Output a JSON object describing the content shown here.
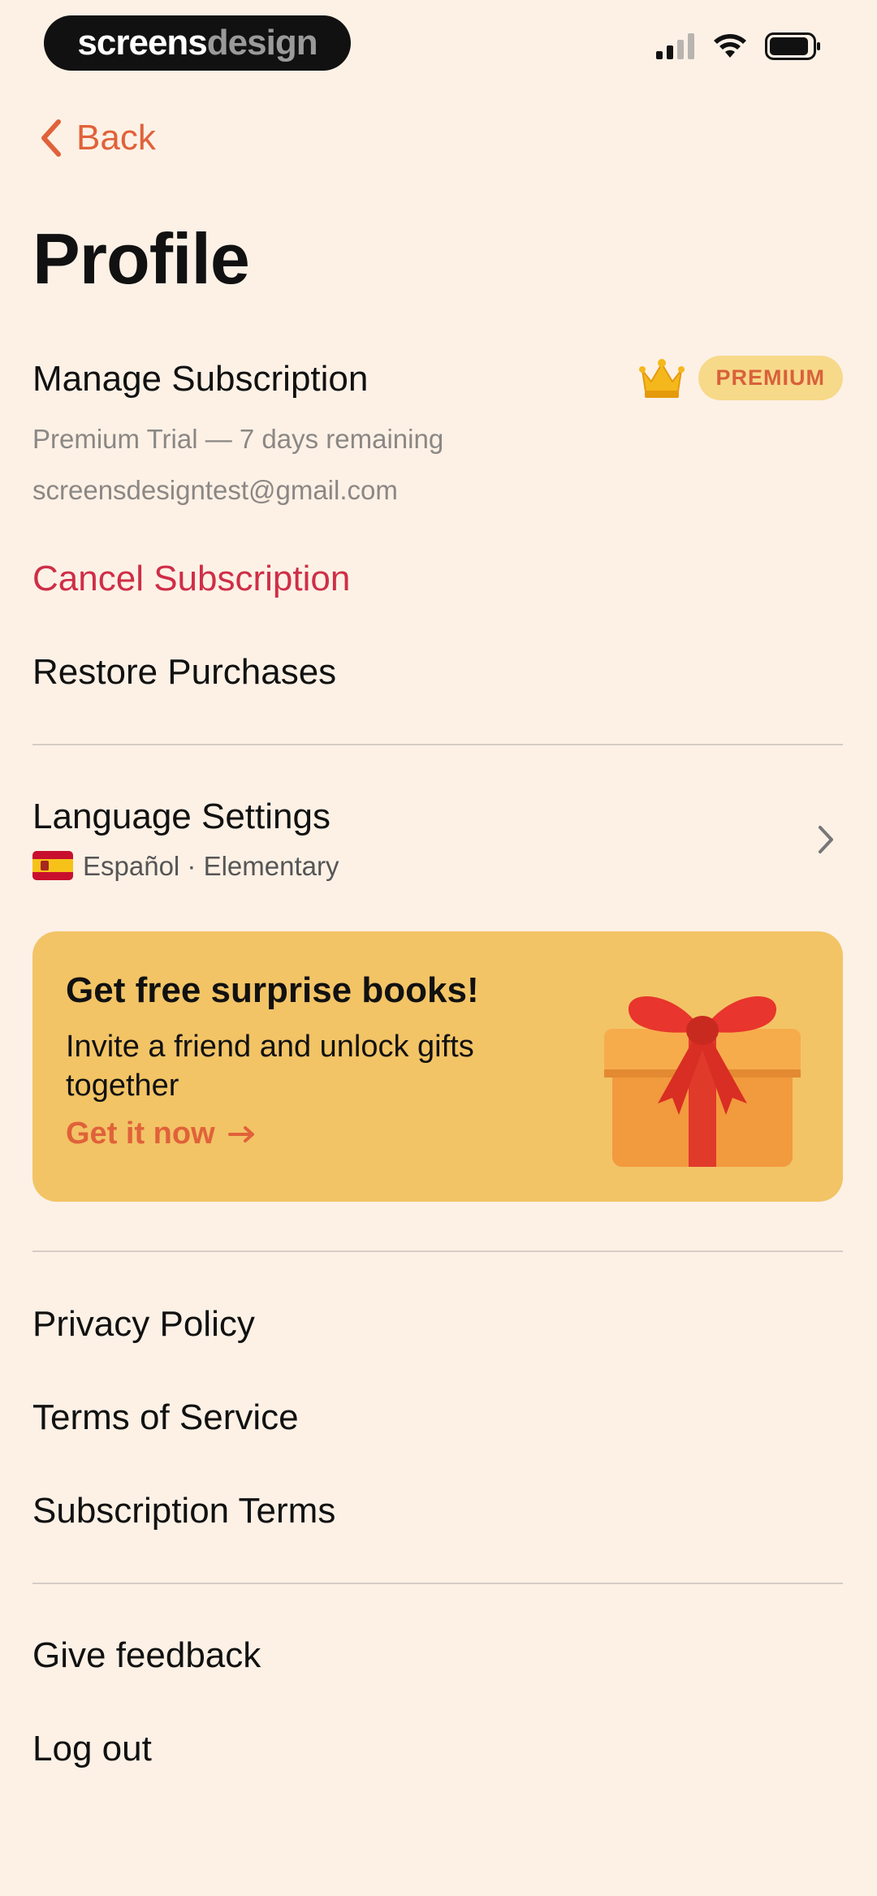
{
  "status_bar": {
    "brand_part1": "screens",
    "brand_part2": "design"
  },
  "nav": {
    "back_label": "Back"
  },
  "page": {
    "title": "Profile"
  },
  "subscription": {
    "heading": "Manage Subscription",
    "badge": "PREMIUM",
    "trial_text": "Premium Trial — 7 days remaining",
    "email": "screensdesigntest@gmail.com",
    "cancel_label": "Cancel Subscription",
    "restore_label": "Restore Purchases"
  },
  "language": {
    "heading": "Language Settings",
    "value": "Español · Elementary"
  },
  "promo": {
    "title": "Get free surprise books!",
    "text": "Invite a friend and unlock gifts together",
    "cta": "Get it now"
  },
  "links": {
    "privacy": "Privacy Policy",
    "terms": "Terms of Service",
    "subscription_terms": "Subscription Terms",
    "feedback": "Give feedback",
    "logout": "Log out"
  },
  "colors": {
    "background": "#fdf1e6",
    "accent": "#e0623a",
    "danger": "#cf2e47",
    "banner": "#f2c466",
    "badge": "#f7d98a"
  },
  "icons": {
    "back": "chevron-left-icon",
    "crown": "crown-icon",
    "chevron": "chevron-right-icon",
    "flag": "spain-flag-icon",
    "gift": "gift-icon",
    "arrow": "arrow-right-icon"
  }
}
